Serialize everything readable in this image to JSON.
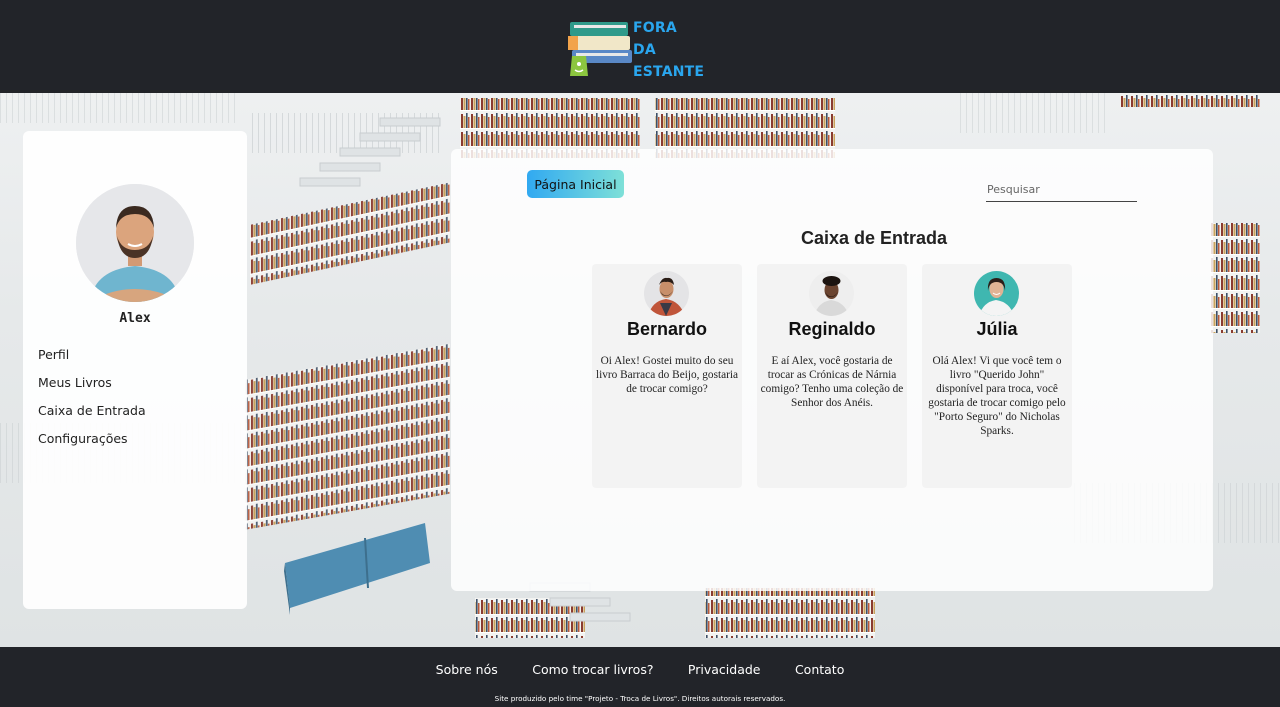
{
  "header": {
    "logo_line1": "FORA",
    "logo_line2": "DA ESTANTE"
  },
  "sidebar": {
    "user_name": "Alex",
    "menu": [
      {
        "label": "Perfil"
      },
      {
        "label": "Meus Livros"
      },
      {
        "label": "Caixa de Entrada"
      },
      {
        "label": "Configurações"
      }
    ]
  },
  "main": {
    "home_button": "Página Inicial",
    "search_placeholder": "Pesquisar",
    "inbox_title": "Caixa de Entrada",
    "messages": [
      {
        "name": "Bernardo",
        "text": "Oi Alex! Gostei muito do seu livro Barraca do Beijo, gostaria de trocar comigo?"
      },
      {
        "name": "Reginaldo",
        "text": "E aí Alex, você gostaria de trocar as Crónicas de Nárnia comigo? Tenho uma coleção de Senhor dos Anéis."
      },
      {
        "name": "Júlia",
        "text": "Olá Alex! Vi que você tem o livro \"Querido John\" disponível para troca, você gostaria de trocar comigo pelo \"Porto Seguro\" do Nicholas Sparks."
      }
    ]
  },
  "footer": {
    "links": [
      {
        "label": "Sobre nós"
      },
      {
        "label": "Como trocar livros?"
      },
      {
        "label": "Privacidade"
      },
      {
        "label": "Contato"
      }
    ],
    "copyright": "Site produzido pelo time \"Projeto - Troca de Livros\". Direitos autorais reservados."
  },
  "colors": {
    "header_bg": "#222429",
    "logo_blue": "#2aa6ee",
    "button_gradient_start": "#31a9f1",
    "button_gradient_end": "#7ee0d8"
  }
}
